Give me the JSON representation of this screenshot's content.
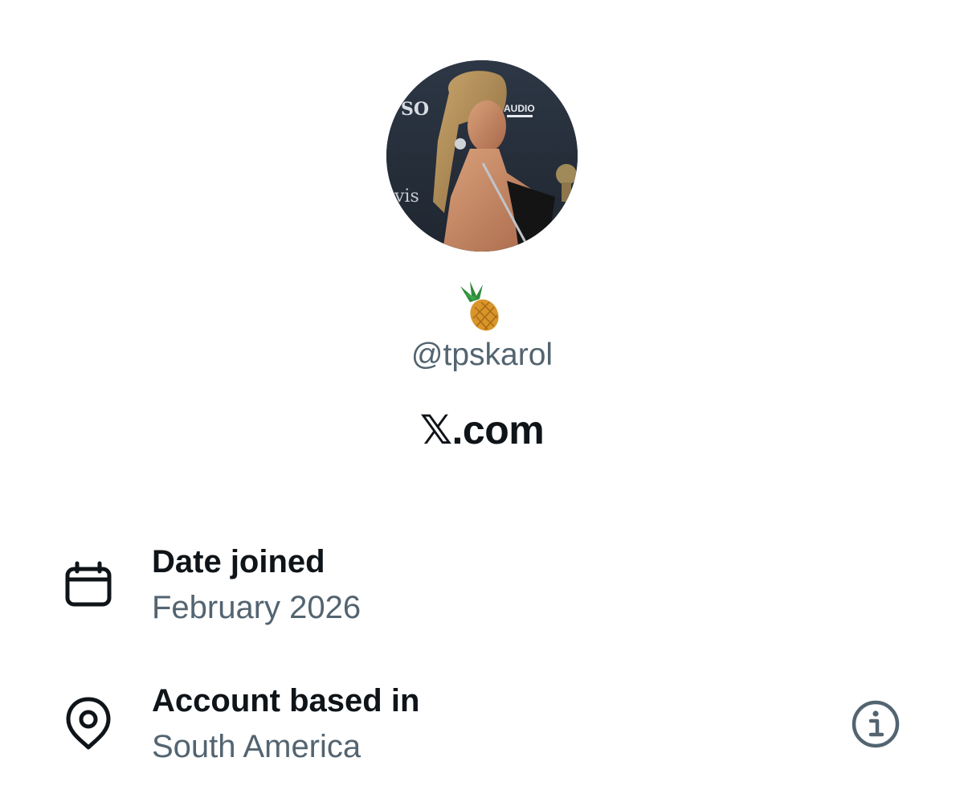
{
  "profile": {
    "avatar_icon": "profile-photo",
    "emoji_icon": "pineapple-emoji",
    "handle": "@tpskarol",
    "brand": "𝕏.com",
    "avatar_text_left": "SO",
    "avatar_text_right": "AUDIO",
    "avatar_text_bottom": "vis"
  },
  "details": {
    "date_joined": {
      "icon": "calendar-icon",
      "label": "Date joined",
      "value": "February 2026"
    },
    "location": {
      "icon": "location-pin-icon",
      "label": "Account based in",
      "value": "South America",
      "info_icon": "info-icon"
    }
  },
  "colors": {
    "primary_text": "#0f1419",
    "secondary_text": "#536471",
    "background": "#ffffff"
  }
}
